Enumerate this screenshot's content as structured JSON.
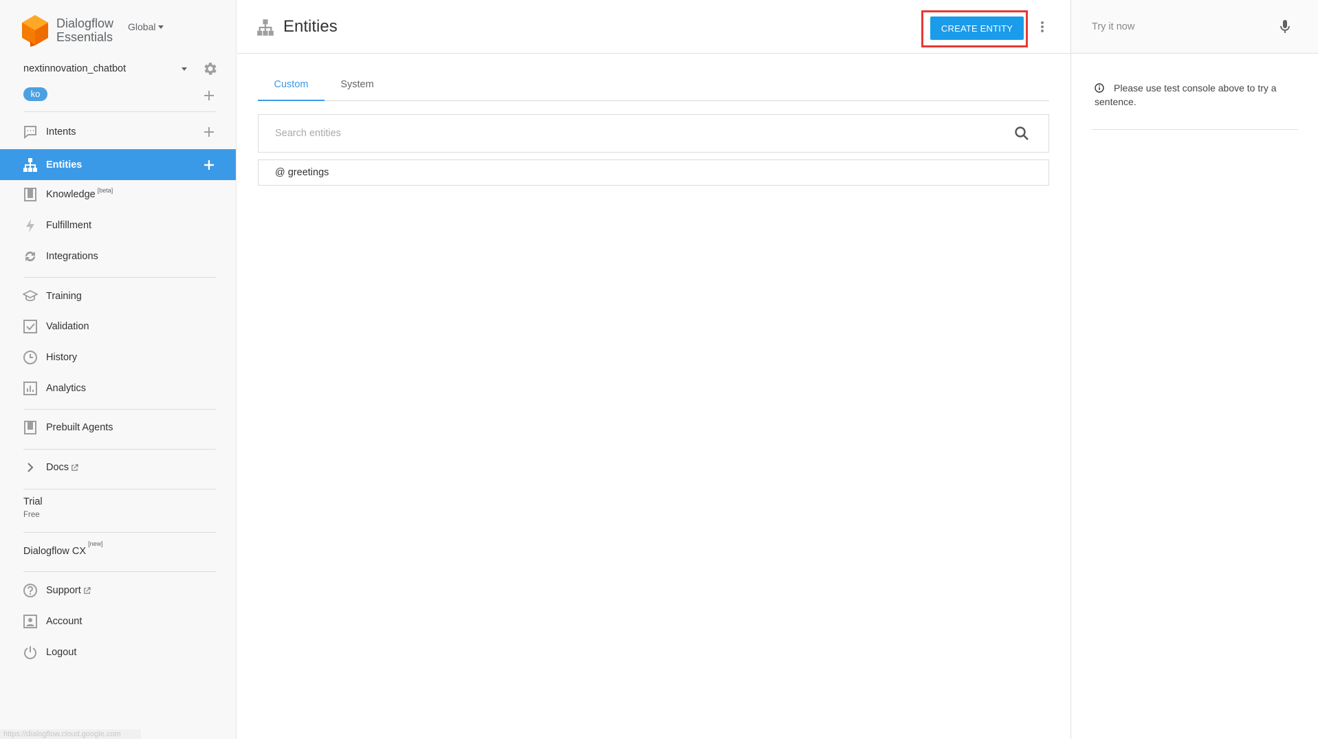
{
  "brand": {
    "line1": "Dialogflow",
    "line2": "Essentials",
    "logo_color": "#f57c00"
  },
  "region": "Global",
  "agent": {
    "name": "nextinnovation_chatbot",
    "language": "ko"
  },
  "nav": {
    "intents": "Intents",
    "entities": "Entities",
    "knowledge": "Knowledge",
    "knowledge_tag": "[beta]",
    "fulfillment": "Fulfillment",
    "integrations": "Integrations",
    "training": "Training",
    "validation": "Validation",
    "history": "History",
    "analytics": "Analytics",
    "prebuilt": "Prebuilt Agents",
    "docs": "Docs",
    "support": "Support",
    "account": "Account",
    "logout": "Logout"
  },
  "plan": {
    "name": "Trial",
    "tier": "Free"
  },
  "cx": {
    "label": "Dialogflow CX",
    "tag": "[new]"
  },
  "status_url": "https://dialogflow.cloud.google.com",
  "main": {
    "title": "Entities",
    "create_button": "CREATE ENTITY",
    "tabs": {
      "custom": "Custom",
      "system": "System"
    },
    "search_placeholder": "Search entities",
    "entities": [
      "@ greetings"
    ]
  },
  "right": {
    "try_placeholder": "Try it now",
    "hint": "Please use test console above to try a sentence."
  },
  "colors": {
    "accent": "#3b9ae8",
    "button": "#1a9cea",
    "highlight_frame": "#e53935"
  }
}
